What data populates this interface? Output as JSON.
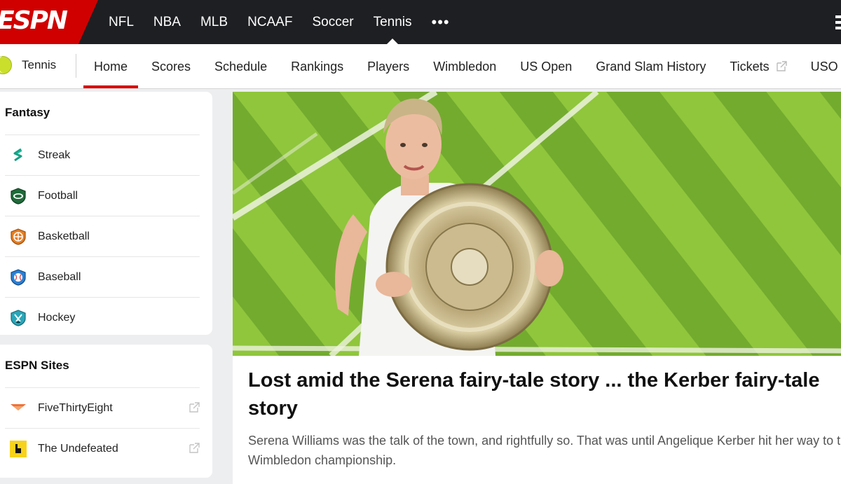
{
  "topnav": {
    "logo": "ESPN",
    "sports": [
      "NFL",
      "NBA",
      "MLB",
      "NCAAF",
      "Soccer",
      "Tennis"
    ],
    "active_sport": "Tennis",
    "more_label": "•••"
  },
  "subnav": {
    "title": "Tennis",
    "links": [
      "Home",
      "Scores",
      "Schedule",
      "Rankings",
      "Players",
      "Wimbledon",
      "US Open",
      "Grand Slam History",
      "Tickets",
      "USO"
    ],
    "active_link": "Home"
  },
  "sidebar": {
    "fantasy": {
      "heading": "Fantasy",
      "items": [
        {
          "label": "Streak",
          "icon": "streak-icon"
        },
        {
          "label": "Football",
          "icon": "football-icon"
        },
        {
          "label": "Basketball",
          "icon": "basketball-icon"
        },
        {
          "label": "Baseball",
          "icon": "baseball-icon"
        },
        {
          "label": "Hockey",
          "icon": "hockey-icon"
        }
      ]
    },
    "sites": {
      "heading": "ESPN Sites",
      "items": [
        {
          "label": "FiveThirtyEight",
          "icon": "fivethirtyeight-icon"
        },
        {
          "label": "The Undefeated",
          "icon": "undefeated-icon"
        }
      ]
    }
  },
  "story": {
    "headline": "Lost amid the Serena fairy-tale story ... the Kerber fairy-tale story",
    "summary": "Serena Williams was the talk of the town, and rightfully so. That was until Angelique Kerber hit her way to the Wimbledon championship."
  },
  "colors": {
    "espn_red": "#d00000",
    "nav_bg": "#1e1f22",
    "grass_light": "#8cc63f",
    "grass_dark": "#6aa52c"
  }
}
